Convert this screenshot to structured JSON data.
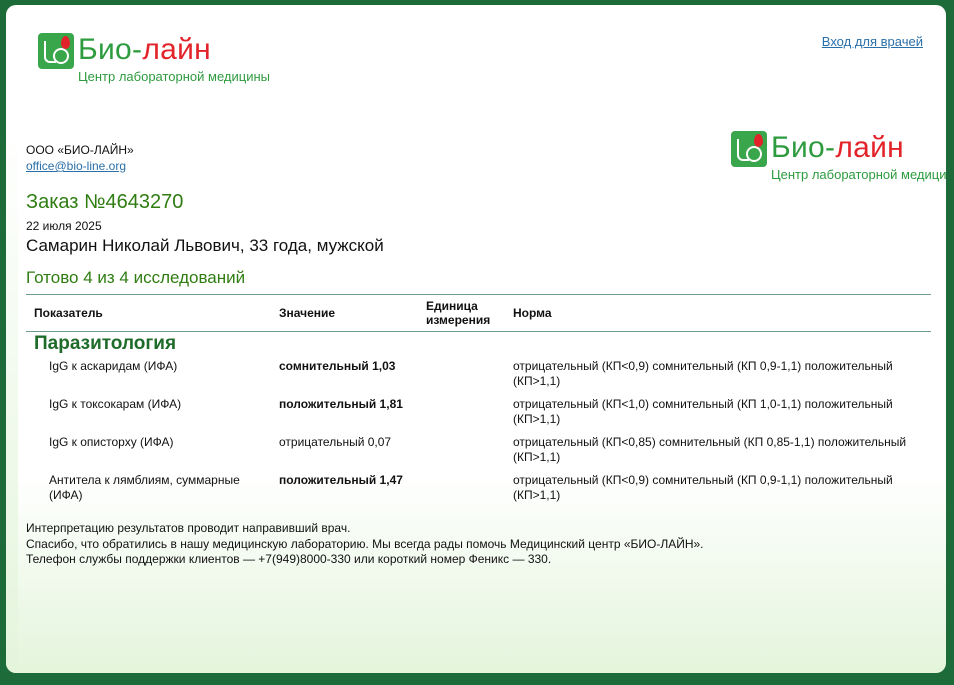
{
  "header": {
    "logo_name_part1": "Био-",
    "logo_name_part2": "лайн",
    "logo_subtitle": "Центр лабораторной медицины",
    "doctor_link": "Вход для врачей"
  },
  "company": {
    "name": "ООО «БИО-ЛАЙН»",
    "email": "office@bio-line.org"
  },
  "order": {
    "title": "Заказ №4643270",
    "date": "22 июля 2025",
    "patient": "Самарин Николай Львович, 33 года, мужской",
    "status": "Готово 4 из 4 исследований"
  },
  "table": {
    "headers": [
      "Показатель",
      "Значение",
      "Единица измерения",
      "Норма"
    ],
    "section": "Паразитология",
    "rows": [
      {
        "name": "IgG к аскаридам (ИФА)",
        "value": "сомнительный 1,03",
        "unit": "",
        "norm": "отрицательный (КП<0,9) сомнительный (КП 0,9-1,1) положительный (КП>1,1)"
      },
      {
        "name": "IgG к токсокарам (ИФА)",
        "value": "положительный 1,81",
        "unit": "",
        "norm": "отрицательный (КП<1,0) сомнительный (КП 1,0-1,1) положительный (КП>1,1)"
      },
      {
        "name": "IgG к описторху (ИФА)",
        "value": "отрицательный 0,07",
        "unit": "",
        "norm": "отрицательный (КП<0,85) сомнительный (КП 0,85-1,1) положительный (КП>1,1)"
      },
      {
        "name": "Антитела к лямблиям, суммарные (ИФА)",
        "value": "положительный 1,47",
        "unit": "",
        "norm": "отрицательный (КП<0,9) сомнительный (КП 0,9-1,1) положительный (КП>1,1)"
      }
    ]
  },
  "footer": {
    "line1": "Интерпретацию результатов проводит направивший врач.",
    "line2": "Спасибо, что обратились в нашу медицинскую лабораторию. Мы всегда рады помочь Медицинский центр «БИО-ЛАЙН».",
    "line3": "Телефон службы поддержки клиентов — +7(949)8000-330 или короткий номер Феникс — 330."
  },
  "colors": {
    "brand_green": "#2e9b3f",
    "brand_red": "#e2232a",
    "title_green": "#2f7d12",
    "link_blue": "#2a6fa8"
  }
}
